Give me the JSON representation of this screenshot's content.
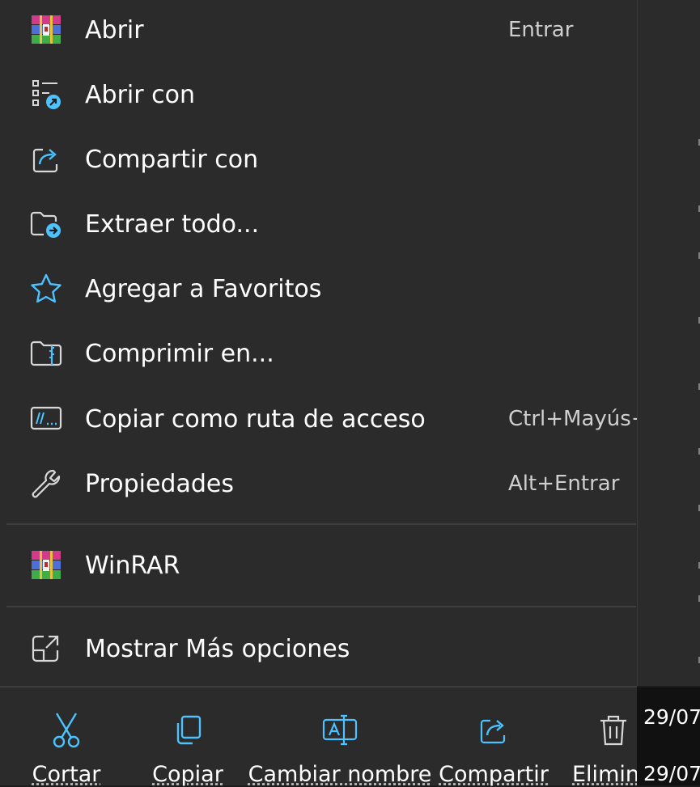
{
  "menu": {
    "items": [
      {
        "label": "Abrir",
        "shortcut": "Entrar",
        "icon": "winrar-icon"
      },
      {
        "label": "Abrir con",
        "shortcut": "",
        "icon": "open-with-icon"
      },
      {
        "label": "Compartir con",
        "shortcut": "",
        "icon": "share-icon"
      },
      {
        "label": "Extraer todo...",
        "shortcut": "",
        "icon": "extract-folder-icon"
      },
      {
        "label": "Agregar a Favoritos",
        "shortcut": "",
        "icon": "star-icon"
      },
      {
        "label": "Comprimir en...",
        "shortcut": "",
        "icon": "zip-folder-icon"
      },
      {
        "label": "Copiar como ruta de acceso",
        "shortcut": "Ctrl+Mayús+",
        "icon": "copy-path-icon"
      },
      {
        "label": "Propiedades",
        "shortcut": "Alt+Entrar",
        "icon": "wrench-icon"
      }
    ],
    "winrar": {
      "label": "WinRAR",
      "icon": "winrar-icon"
    },
    "more": {
      "label": "Mostrar Más opciones",
      "icon": "more-options-icon"
    }
  },
  "toolbar": {
    "buttons": [
      {
        "label": "Cortar",
        "icon": "scissors-icon"
      },
      {
        "label": "Copiar",
        "icon": "copy-icon"
      },
      {
        "label": "Cambiar nombre",
        "icon": "rename-icon"
      },
      {
        "label": "Compartir",
        "icon": "share-icon"
      },
      {
        "label": "Eliminar",
        "icon": "trash-icon"
      }
    ]
  },
  "background": {
    "dates": [
      "29/07",
      "29/07"
    ]
  },
  "colors": {
    "menu_bg": "#2b2b2b",
    "accent": "#4cc2ff",
    "separator": "#3e3e3e"
  }
}
